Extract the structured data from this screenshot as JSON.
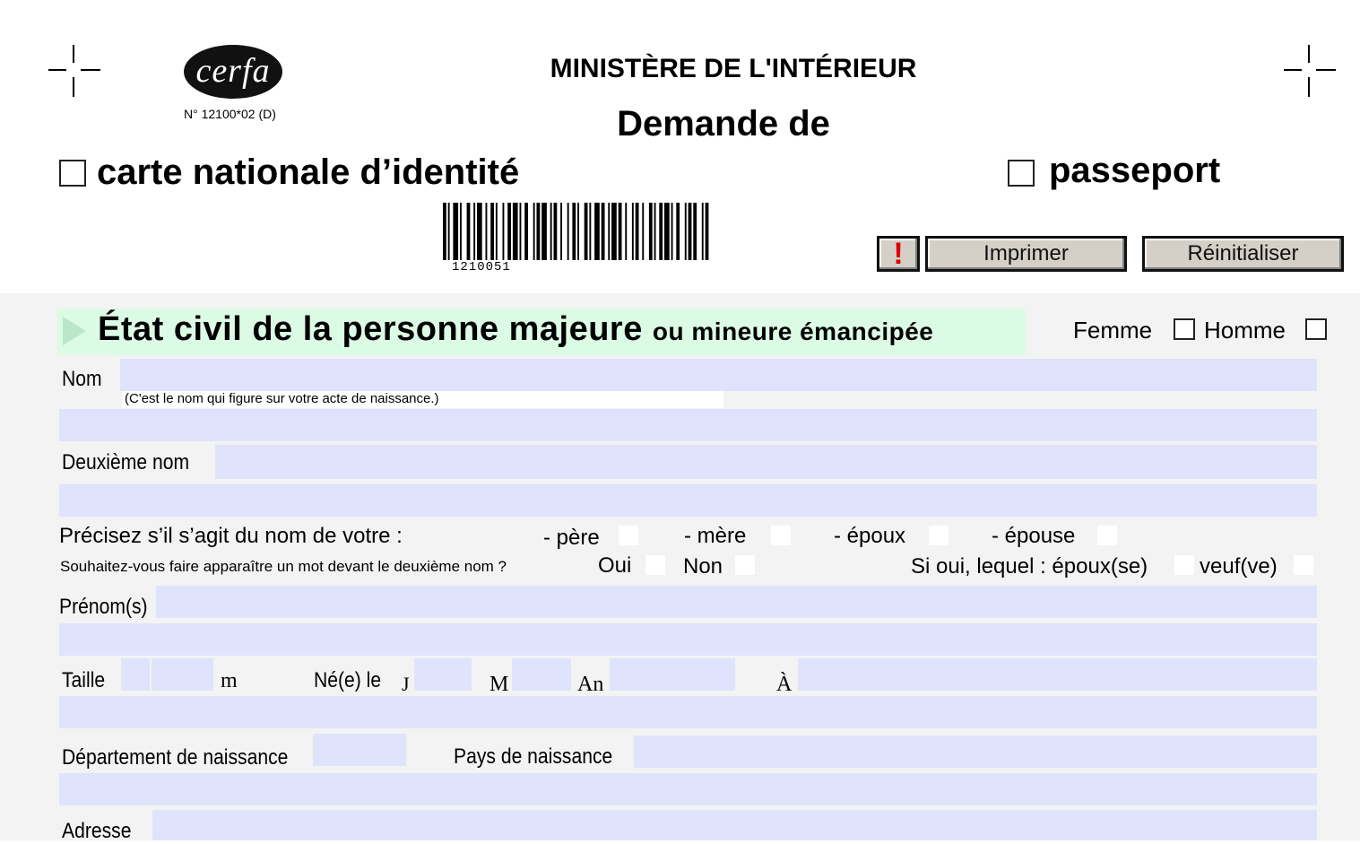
{
  "header": {
    "logo_text": "cerfa",
    "cerfa_number": "N° 12100*02 (D)",
    "ministry": "MINISTÈRE DE L'INTÉRIEUR",
    "demande": "Demande de",
    "option_cni": "carte nationale d’identité",
    "option_passport": "passeport",
    "barcode_number": "1210051"
  },
  "toolbar": {
    "alert_label": "!",
    "print_label": "Imprimer",
    "reset_label": "Réinitialiser"
  },
  "section": {
    "title_main": "État civil de la personne majeure",
    "title_sub": "ou mineure émancipée",
    "femme": "Femme",
    "homme": "Homme"
  },
  "form": {
    "nom_label": "Nom",
    "nom_note": "(C'est le nom qui figure sur votre acte de naissance.)",
    "deuxieme_nom_label": "Deuxième nom",
    "precisez_label": "Précisez s’il s’agit du nom de votre :",
    "pere": "- père",
    "mere": "- mère",
    "epoux": "- époux",
    "epouse": "- épouse",
    "souhaitez_label": "Souhaitez-vous faire apparaître un mot devant le deuxième nom ?",
    "oui": "Oui",
    "non": "Non",
    "si_oui": "Si oui, lequel : époux(se)",
    "veuf": "veuf(ve)",
    "prenoms_label": "Prénom(s)",
    "taille_label": "Taille",
    "taille_unit": "m",
    "ne_le_label": "Né(e) le",
    "jour": "J",
    "mois": "M",
    "annee": "An",
    "a_label": "À",
    "departement_label": "Département de naissance",
    "pays_label": "Pays de naissance",
    "adresse_label": "Adresse"
  }
}
